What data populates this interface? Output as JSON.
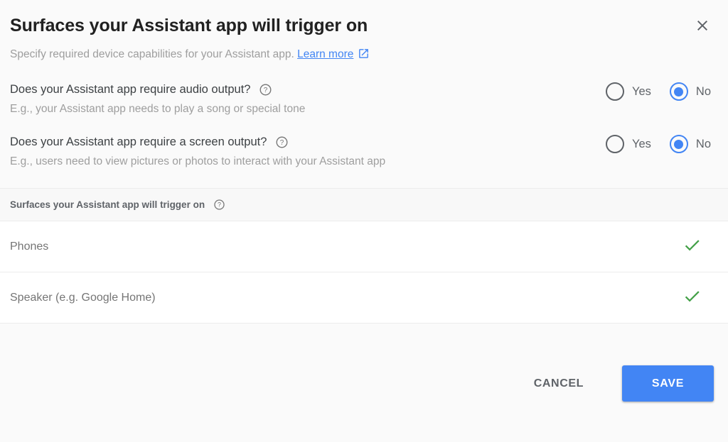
{
  "dialog": {
    "title": "Surfaces your Assistant app will trigger on",
    "close_icon": "close-icon",
    "subtitle_text": "Specify required device capabilities for your Assistant app.",
    "learn_more_label": "Learn more",
    "external_link_icon": "external-link-icon"
  },
  "questions": [
    {
      "label": "Does your Assistant app require audio output?",
      "help_icon": "help-icon",
      "description": "E.g., your Assistant app needs to play a song or special tone",
      "options": [
        {
          "label": "Yes",
          "selected": false
        },
        {
          "label": "No",
          "selected": true
        }
      ]
    },
    {
      "label": "Does your Assistant app require a screen output?",
      "help_icon": "help-icon",
      "description": "E.g., users need to view pictures or photos to interact with your Assistant app",
      "options": [
        {
          "label": "Yes",
          "selected": false
        },
        {
          "label": "No",
          "selected": true
        }
      ]
    }
  ],
  "surfaces": {
    "header_label": "Surfaces your Assistant app will trigger on",
    "header_help_icon": "help-icon",
    "rows": [
      {
        "label": "Phones",
        "status_icon": "check-icon",
        "enabled": true
      },
      {
        "label": "Speaker (e.g. Google Home)",
        "status_icon": "check-icon",
        "enabled": true
      }
    ]
  },
  "footer": {
    "cancel_label": "CANCEL",
    "save_label": "SAVE"
  },
  "colors": {
    "accent_blue": "#4285f4",
    "check_green": "#43a047",
    "title_text": "#212121",
    "muted_text": "#9e9e9e",
    "body_text": "#5f6368",
    "dialog_background": "#fafafa",
    "row_background": "#ffffff",
    "divider": "#ececec"
  }
}
